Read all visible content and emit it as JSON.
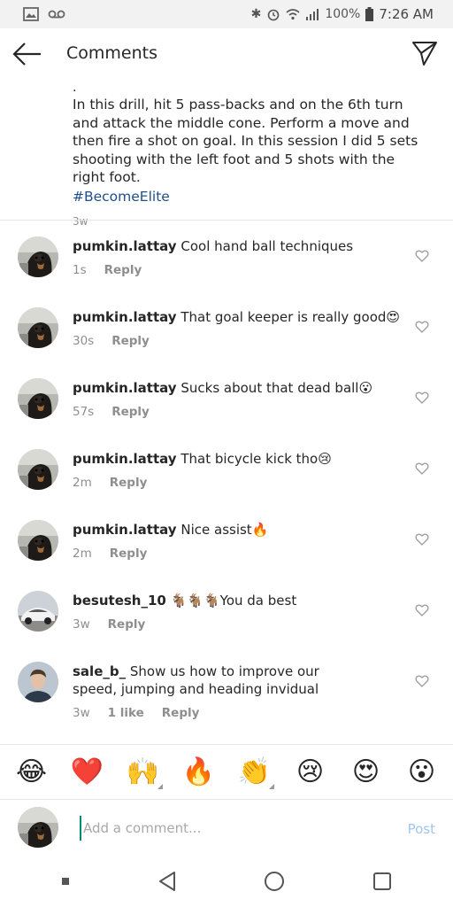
{
  "status_bar": {
    "battery": "100%",
    "time": "7:26 AM"
  },
  "header": {
    "title": "Comments"
  },
  "caption": {
    "dot": ".",
    "text": "In this drill, hit 5 pass-backs and on the 6th turn and attack the middle cone. Perform a move and then fire a shot on goal. In this session I did 5 sets shooting with the left foot and 5 shots with the right foot.",
    "hashtag": "#BecomeElite",
    "time": "3w"
  },
  "comments": [
    {
      "username": "pumkin.lattay",
      "text": "Cool hand ball techniques",
      "time": "1s",
      "reply": "Reply"
    },
    {
      "username": "pumkin.lattay",
      "text": "That goal keeper is really good😍",
      "time": "30s",
      "reply": "Reply"
    },
    {
      "username": "pumkin.lattay",
      "text": "Sucks about that dead ball😮",
      "time": "57s",
      "reply": "Reply"
    },
    {
      "username": "pumkin.lattay",
      "text": "That bicycle kick tho😢",
      "time": "2m",
      "reply": "Reply"
    },
    {
      "username": "pumkin.lattay",
      "text": "Nice assist🔥",
      "time": "2m",
      "reply": "Reply"
    },
    {
      "username": "besutesh_10",
      "text": "🐐🐐🐐You da best",
      "time": "3w",
      "reply": "Reply"
    },
    {
      "username": "sale_b_",
      "text": "Show us how to improve our speed, jumping and heading invidual",
      "time": "3w",
      "likes": "1 like",
      "reply": "Reply"
    }
  ],
  "emoji_bar": [
    "😂",
    "❤️",
    "🙌",
    "🔥",
    "👏",
    "😢",
    "😍",
    "😮"
  ],
  "input": {
    "placeholder": "Add a comment...",
    "post_label": "Post"
  }
}
